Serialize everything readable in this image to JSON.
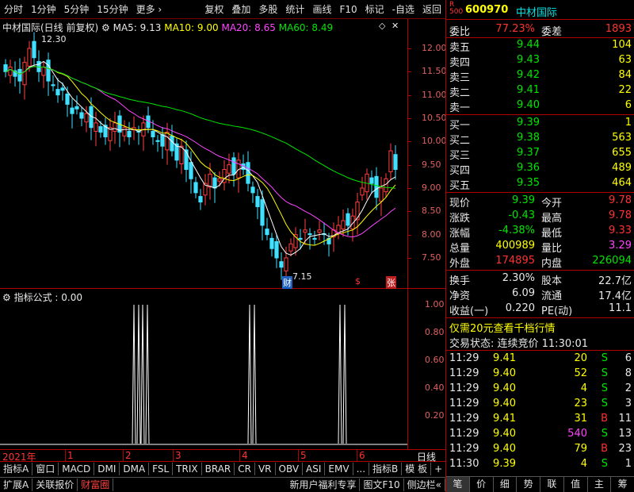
{
  "toolbar": [
    "分时",
    "1分钟",
    "5分钟",
    "15分钟",
    "更多 ›",
    "复权",
    "叠加",
    "多股",
    "统计",
    "画线",
    "F10",
    "标记",
    "-自选",
    "返回"
  ],
  "chart": {
    "title": "中材国际(日线 前复权)",
    "ma5": "MA5: 9.13",
    "ma10": "MA10: 9.00",
    "ma20": "MA20: 8.65",
    "ma60": "MA60: 8.49",
    "high_label": "12.30",
    "low_label": "7.15",
    "price_ticks": [
      "12.00",
      "11.50",
      "11.00",
      "10.50",
      "10.00",
      "9.50",
      "9.00",
      "8.50",
      "8.00",
      "7.50"
    ],
    "marker_cai": "财",
    "marker_s": "$",
    "marker_zhang": "张",
    "indicator_title": "指标公式 : 0.00",
    "ind_ticks": [
      "1.00",
      "0.80",
      "0.60",
      "0.40",
      "0.20"
    ],
    "year": "2021年",
    "months": [
      "1",
      "2",
      "3",
      "4",
      "5",
      "6"
    ],
    "date_axis_btn": "日线"
  },
  "indicator_tabs": [
    "指标A",
    "窗口",
    "MACD",
    "DMI",
    "DMA",
    "FSL",
    "TRIX",
    "BRAR",
    "CR",
    "VR",
    "OBV",
    "ASI",
    "EMV",
    "...",
    "指标B",
    "模 板",
    "+",
    "−"
  ],
  "bottom_tabs": [
    "扩展A",
    "关联报价",
    "财富圈"
  ],
  "bottom_right": [
    "新用户福利专享",
    "图文F10",
    "侧边栏«"
  ],
  "stock": {
    "r_label": "R",
    "code_label": "500",
    "code": "600970",
    "name": "中材国际"
  },
  "weibi": {
    "label": "委比",
    "value": "77.23%",
    "label2": "委差",
    "value2": "1893"
  },
  "sells": [
    {
      "label": "卖五",
      "price": "9.44",
      "vol": "104"
    },
    {
      "label": "卖四",
      "price": "9.43",
      "vol": "63"
    },
    {
      "label": "卖三",
      "price": "9.42",
      "vol": "84"
    },
    {
      "label": "卖二",
      "price": "9.41",
      "vol": "22"
    },
    {
      "label": "卖一",
      "price": "9.40",
      "vol": "6"
    }
  ],
  "buys": [
    {
      "label": "买一",
      "price": "9.39",
      "vol": "1"
    },
    {
      "label": "买二",
      "price": "9.38",
      "vol": "563"
    },
    {
      "label": "买三",
      "price": "9.37",
      "vol": "655"
    },
    {
      "label": "买四",
      "price": "9.36",
      "vol": "489"
    },
    {
      "label": "买五",
      "price": "9.35",
      "vol": "464"
    }
  ],
  "quote": [
    {
      "l1": "现价",
      "v1": "9.39",
      "l2": "今开",
      "v2": "9.78"
    },
    {
      "l1": "涨跌",
      "v1": "-0.43",
      "l2": "最高",
      "v2": "9.78"
    },
    {
      "l1": "涨幅",
      "v1": "-4.38%",
      "l2": "最低",
      "v2": "9.33"
    },
    {
      "l1": "总量",
      "v1": "400989",
      "l2": "量比",
      "v2": "3.29"
    },
    {
      "l1": "外盘",
      "v1": "174895",
      "l2": "内盘",
      "v2": "226094"
    }
  ],
  "quote2": [
    {
      "l1": "换手",
      "v1": "2.30%",
      "l2": "股本",
      "v2": "22.7亿"
    },
    {
      "l1": "净资",
      "v1": "6.09",
      "l2": "流通",
      "v2": "17.4亿"
    },
    {
      "l1": "收益(一)",
      "v1": "0.220",
      "l2": "PE(动)",
      "v2": "11.1"
    }
  ],
  "promo": "仅需20元查看千档行情",
  "status": "交易状态: 连续竞价 11:30:01",
  "ticks": [
    {
      "t": "11:29",
      "p": "9.41",
      "v": "20",
      "bs": "S",
      "n": "6"
    },
    {
      "t": "11:29",
      "p": "9.40",
      "v": "52",
      "bs": "S",
      "n": "8"
    },
    {
      "t": "11:29",
      "p": "9.40",
      "v": "4",
      "bs": "S",
      "n": "2"
    },
    {
      "t": "11:29",
      "p": "9.40",
      "v": "23",
      "bs": "S",
      "n": "3"
    },
    {
      "t": "11:29",
      "p": "9.41",
      "v": "31",
      "bs": "B",
      "n": "11"
    },
    {
      "t": "11:29",
      "p": "9.40",
      "v": "540",
      "bs": "S",
      "n": "13"
    },
    {
      "t": "11:29",
      "p": "9.40",
      "v": "79",
      "bs": "B",
      "n": "23"
    },
    {
      "t": "11:30",
      "p": "9.39",
      "v": "4",
      "bs": "S",
      "n": "1"
    }
  ],
  "side_tabs": [
    "笔",
    "价",
    "细",
    "势",
    "联",
    "值",
    "主",
    "筹"
  ]
}
